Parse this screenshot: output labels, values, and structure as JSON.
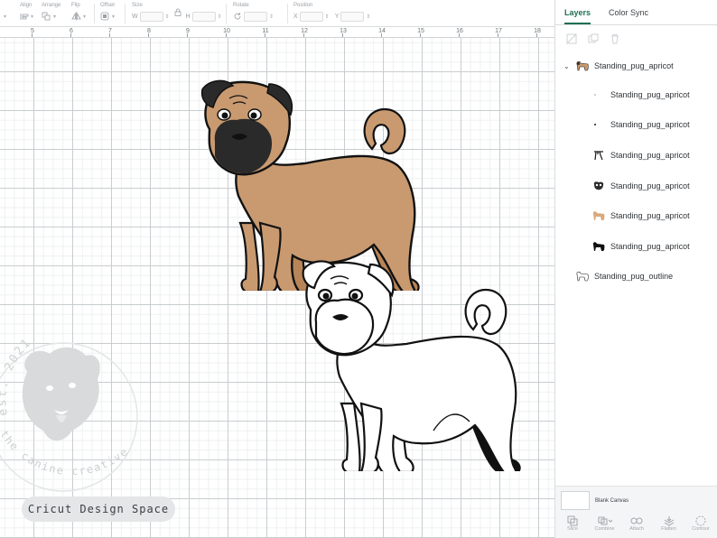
{
  "toolbar": {
    "align_label": "Align",
    "arrange_label": "Arrange",
    "flip_label": "Flip",
    "offset_label": "Offset",
    "size_label": "Size",
    "width_label": "W",
    "height_label": "H",
    "rotate_label": "Rotate",
    "position_label": "Position",
    "x_label": "X",
    "y_label": "Y"
  },
  "ruler": {
    "ticks": [
      "5",
      "6",
      "7",
      "8",
      "9",
      "10",
      "11",
      "12",
      "13",
      "14",
      "15",
      "16",
      "17",
      "18"
    ]
  },
  "canvas": {
    "app_badge": "Cricut Design Space",
    "watermark_text": "the canine creative",
    "watermark_year": "est. 2021"
  },
  "panel": {
    "tabs": [
      {
        "label": "Layers"
      },
      {
        "label": "Color Sync"
      }
    ],
    "layers": {
      "group_name": "Standing_pug_apricot",
      "children": [
        {
          "name": "Standing_pug_apricot",
          "swatch": "#c8a58a"
        },
        {
          "name": "Standing_pug_apricot",
          "swatch": "#1a1a1a"
        },
        {
          "name": "Standing_pug_apricot",
          "swatch": "#1a1a1a"
        },
        {
          "name": "Standing_pug_apricot",
          "swatch": "#2b2b2b"
        },
        {
          "name": "Standing_pug_apricot",
          "swatch": "#d9a97c"
        },
        {
          "name": "Standing_pug_apricot",
          "swatch": "#111111"
        }
      ],
      "outline_name": "Standing_pug_outline"
    },
    "blank_canvas_label": "Blank Canvas",
    "bottom_actions": [
      {
        "label": "Slice",
        "icon": "slice-icon"
      },
      {
        "label": "Combine",
        "icon": "combine-icon"
      },
      {
        "label": "Attach",
        "icon": "attach-icon"
      },
      {
        "label": "Flatten",
        "icon": "flatten-icon"
      },
      {
        "label": "Contour",
        "icon": "contour-icon"
      }
    ]
  },
  "colors": {
    "accent": "#1f6f56",
    "pug_fawn": "#c99a70",
    "pug_mask": "#2a2a2a"
  }
}
